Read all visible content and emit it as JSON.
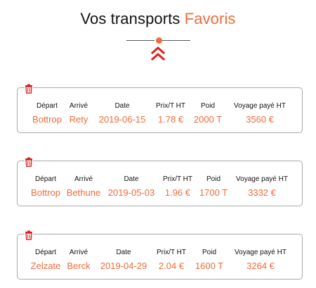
{
  "page": {
    "title_main": "Vos transports",
    "title_accent": "Favoris"
  },
  "icons": {
    "trash": "trash-icon",
    "chevron": "double-chevron-up-icon"
  },
  "colors": {
    "accent": "#f26b3a",
    "trash": "#e0211f",
    "chevron": "#e0211f",
    "border": "#a9a9a9"
  },
  "headers": {
    "depart": "Départ",
    "arrive": "Arrivé",
    "date": "Date",
    "prix": "Prix/T HT",
    "poid": "Poid",
    "voyage": "Voyage payé HT"
  },
  "transports": [
    {
      "depart": "Bottrop",
      "arrive": "Rety",
      "date": "2019-06-15",
      "prix": "1.78 €",
      "poid": "2000 T",
      "voyage": "3560 €"
    },
    {
      "depart": "Bottrop",
      "arrive": "Bethune",
      "date": "2019-05-03",
      "prix": "1.96 €",
      "poid": "1700 T",
      "voyage": "3332 €"
    },
    {
      "depart": "Zelzate",
      "arrive": "Berck",
      "date": "2019-04-29",
      "prix": "2.04 €",
      "poid": "1600 T",
      "voyage": "3264 €"
    }
  ]
}
